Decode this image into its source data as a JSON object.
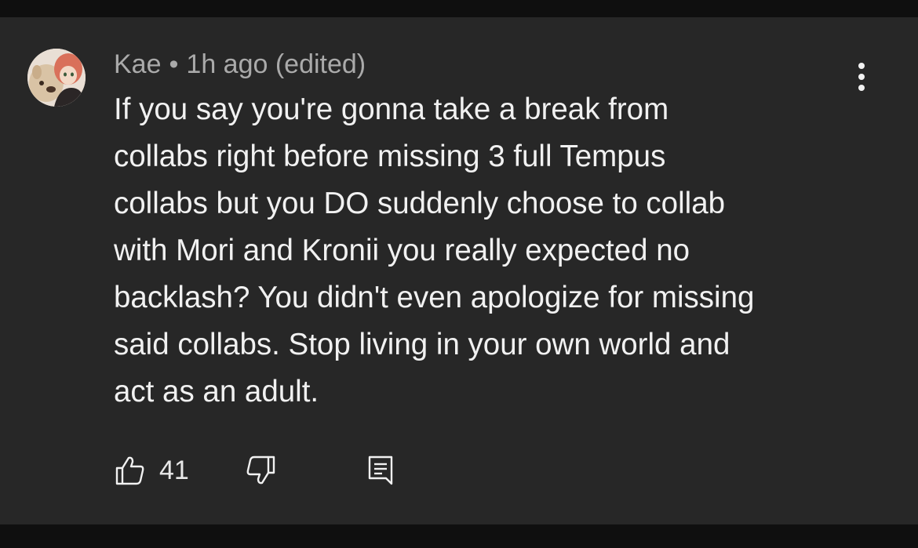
{
  "comment": {
    "author": "Kae",
    "separator": "•",
    "timestamp": "1h ago (edited)",
    "lines": [
      "If you say you're gonna take a break from",
      "collabs right before missing 3 full Tempus",
      "collabs but you DO suddenly choose to collab",
      "with Mori and Kronii you really expected no",
      "backlash? You didn't even apologize for missing",
      "said collabs. Stop living in your own world and",
      "act as an adult."
    ],
    "like_count": "41"
  },
  "icons": {
    "avatar": "avatar-image",
    "more": "more-vertical-icon",
    "like": "thumbs-up-icon",
    "dislike": "thumbs-down-icon",
    "reply": "reply-comment-icon"
  },
  "colors": {
    "page_background": "#0f0f0f",
    "card_background": "#272727",
    "text_primary": "#f1f1f1",
    "text_secondary": "#aaaaaa"
  }
}
